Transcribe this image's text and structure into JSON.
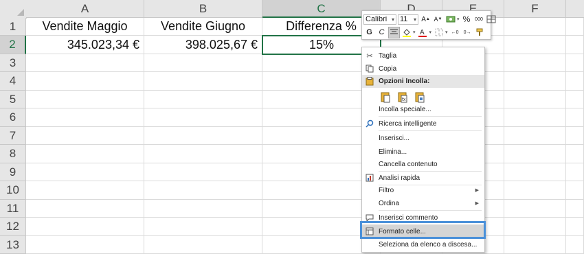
{
  "columns": [
    "A",
    "B",
    "C",
    "D",
    "E",
    "F"
  ],
  "rows": [
    "1",
    "2",
    "3",
    "4",
    "5",
    "6",
    "7",
    "8",
    "9",
    "10",
    "11",
    "12",
    "13"
  ],
  "cells": {
    "A1": "Vendite Maggio",
    "B1": "Vendite Giugno",
    "C1": "Differenza %",
    "A2": "345.023,34 €",
    "B2": "398.025,67 €",
    "C2": "15%"
  },
  "accent_color": "#217346",
  "highlight_color": "#4a90d9",
  "mini_toolbar": {
    "font_name": "Calibri",
    "font_size": "11",
    "bold": "G",
    "italic": "C",
    "percent": "%",
    "thousands": "000",
    "icons": [
      "currency-icon",
      "increase-decimal-icon",
      "decrease-decimal-icon",
      "align-center-icon",
      "fill-color-icon",
      "font-color-icon",
      "borders-icon",
      "merge-icon",
      "format-painter-icon"
    ]
  },
  "context_menu": {
    "cut": "Taglia",
    "copy": "Copia",
    "paste_options": "Opzioni Incolla:",
    "paste_special": "Incolla speciale...",
    "smart_lookup": "Ricerca intelligente",
    "insert": "Inserisci...",
    "delete": "Elimina...",
    "clear_contents": "Cancella contenuto",
    "quick_analysis": "Analisi rapida",
    "filter": "Filtro",
    "sort": "Ordina",
    "insert_comment": "Inserisci commento",
    "format_cells": "Formato celle...",
    "pick_from_list": "Seleziona da elenco a discesa..."
  }
}
